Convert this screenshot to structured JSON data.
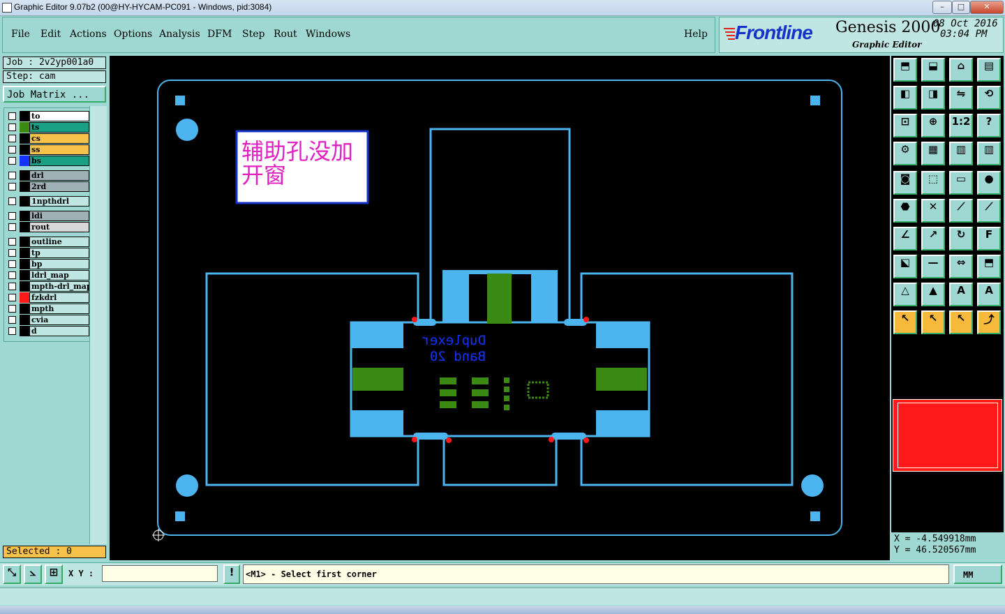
{
  "window": {
    "title": "Graphic Editor 9.07b2 (00@HY-HYCAM-PC091 - Windows, pid:3084)",
    "minimize": "–",
    "maximize": "□",
    "close": "✕"
  },
  "menu": {
    "items": [
      {
        "label": "File"
      },
      {
        "label": "Edit"
      },
      {
        "label": "Actions"
      },
      {
        "label": "Options"
      },
      {
        "label": "Analysis"
      },
      {
        "label": "DFM"
      },
      {
        "label": "Step"
      },
      {
        "label": "Rout"
      },
      {
        "label": "Windows"
      }
    ],
    "help": "Help"
  },
  "brand": {
    "logo": "Frontline",
    "product": "Genesis 2000",
    "subtitle": "Graphic Editor",
    "date": "08 Oct 2016",
    "time": "03:04 PM"
  },
  "job": {
    "job_label": "Job  : 2v2yp001a0",
    "step_label": "Step: cam",
    "matrix_button": "Job Matrix ..."
  },
  "layers": [
    {
      "name": "to",
      "bg": "#ffffff",
      "swatch": "#000000"
    },
    {
      "name": "ts",
      "bg": "#1aa085",
      "swatch": "#3a8a14"
    },
    {
      "name": "cs",
      "bg": "#f6c24a",
      "swatch": "#000000"
    },
    {
      "name": "ss",
      "bg": "#f6c24a",
      "swatch": "#000000"
    },
    {
      "name": "bs",
      "bg": "#1aa085",
      "swatch": "#1533ff"
    },
    {
      "name": "drl",
      "bg": "#9fb0b6",
      "swatch": "#000000"
    },
    {
      "name": "2rd",
      "bg": "#9fb0b6",
      "swatch": "#000000"
    },
    {
      "name": "1npthdrl",
      "bg": "#bfe6e2",
      "swatch": "#000000"
    },
    {
      "name": "ldi",
      "bg": "#9fb0b6",
      "swatch": "#000000"
    },
    {
      "name": "rout",
      "bg": "#d8d8d8",
      "swatch": "#000000"
    },
    {
      "name": "outline",
      "bg": "#bfe6e2",
      "swatch": "#000000"
    },
    {
      "name": "tp",
      "bg": "#bfe6e2",
      "swatch": "#000000"
    },
    {
      "name": "bp",
      "bg": "#bfe6e2",
      "swatch": "#000000"
    },
    {
      "name": "ldrl_map",
      "bg": "#bfe6e2",
      "swatch": "#000000"
    },
    {
      "name": "mpth-drl_map",
      "bg": "#bfe6e2",
      "swatch": "#000000"
    },
    {
      "name": "fzkdrl",
      "bg": "#bfe6e2",
      "swatch": "#ff1a1a"
    },
    {
      "name": "mpth",
      "bg": "#bfe6e2",
      "swatch": "#000000"
    },
    {
      "name": "cvia",
      "bg": "#bfe6e2",
      "swatch": "#000000"
    },
    {
      "name": "d",
      "bg": "#bfe6e2",
      "swatch": "#000000"
    }
  ],
  "selected": "Selected : 0",
  "canvas": {
    "note_text_line1": "辅助孔没加",
    "note_text_line2": "开窗",
    "silk_line1": "Duplexer",
    "silk_line2": "Band 20"
  },
  "colors": {
    "copper": "#4cb4ee",
    "green": "#3a8a14",
    "red": "#ff1a1a",
    "magenta": "#e020c0"
  },
  "coords": {
    "x": "X = -4.549918mm",
    "y": "Y = 46.520567mm"
  },
  "command": {
    "xy_label": "X Y :",
    "xy_value": "",
    "prompt": "<M1> - Select first corner",
    "units": "MM"
  }
}
